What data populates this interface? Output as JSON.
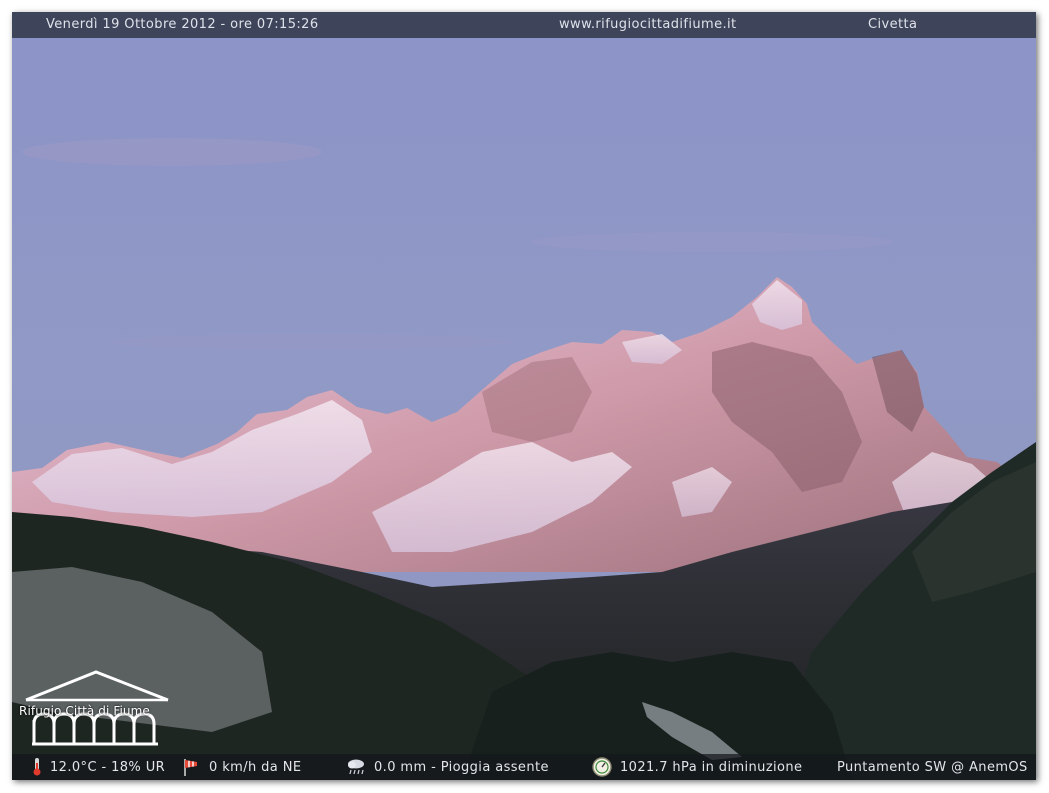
{
  "header": {
    "datetime": "Venerdì 19 Ottobre 2012 - ore 07:15:26",
    "website": "www.rifugiocittadifiume.it",
    "location": "Civetta"
  },
  "logo": {
    "text": "Rifugio Città di Fiume"
  },
  "footer": {
    "temperature_humidity": "12.0°C - 18% UR",
    "wind": "0 km/h da NE",
    "rain": "0.0 mm - Pioggia assente",
    "pressure": "1021.7 hPa in diminuzione",
    "orientation": "Puntamento SW @ AnemOS"
  },
  "icons": {
    "temperature": "thermometer-icon",
    "wind": "windsock-icon",
    "rain": "rain-cloud-icon",
    "pressure": "barometer-icon"
  },
  "colors": {
    "sky": "#8e97c6",
    "peak_alpenglow": "#e4b8d0",
    "forest": "#1c2420",
    "bar": "#3e4459"
  }
}
